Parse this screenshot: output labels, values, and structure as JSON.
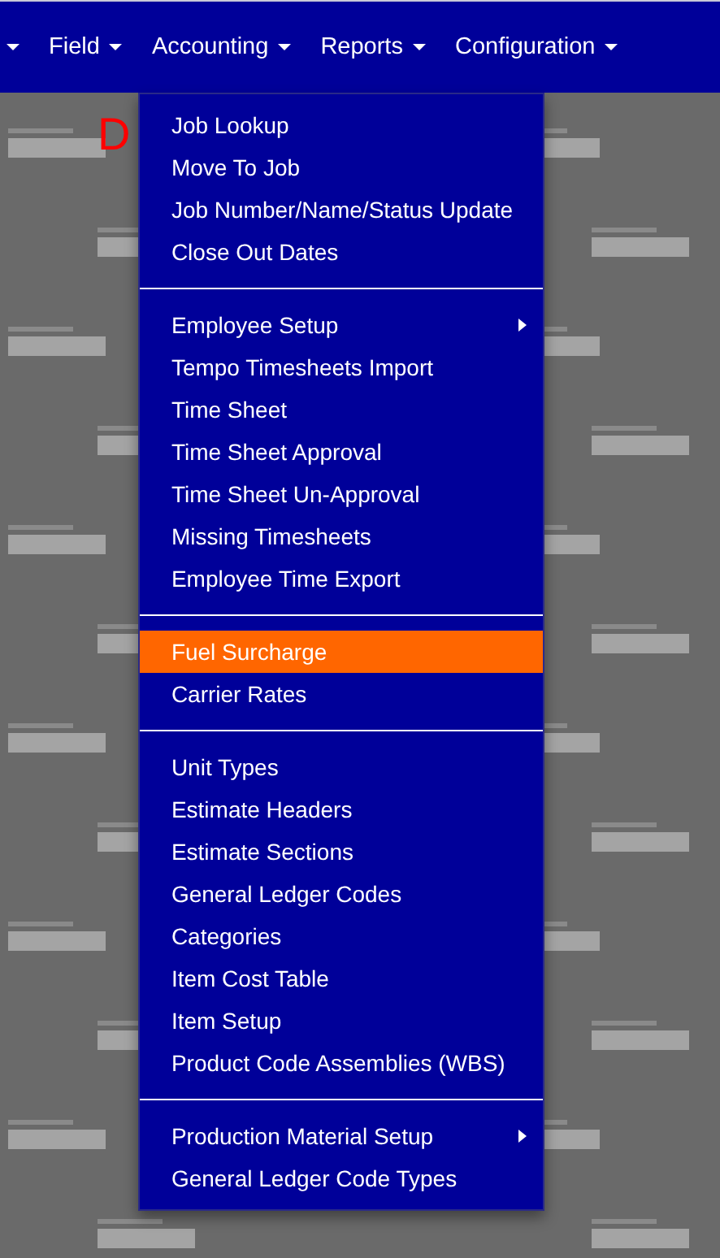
{
  "nav": [
    {
      "expanded": false
    },
    {
      "label": "Field",
      "expanded": false
    },
    {
      "label": "Accounting",
      "expanded": true
    },
    {
      "label": "Reports",
      "expanded": false
    },
    {
      "label": "Configuration",
      "expanded": false
    }
  ],
  "page": {
    "heading": "D"
  },
  "menu": {
    "sections": [
      {
        "items": [
          {
            "label": "Job Lookup",
            "selected": false,
            "has_submenu": false
          },
          {
            "label": "Move To Job",
            "selected": false,
            "has_submenu": false
          },
          {
            "label": "Job Number/Name/Status Update",
            "selected": false,
            "has_submenu": false
          },
          {
            "label": "Close Out Dates",
            "selected": false,
            "has_submenu": false
          }
        ]
      },
      {
        "items": [
          {
            "label": "Employee Setup",
            "selected": false,
            "has_submenu": true
          },
          {
            "label": "Tempo Timesheets Import",
            "selected": false,
            "has_submenu": false
          },
          {
            "label": "Time Sheet",
            "selected": false,
            "has_submenu": false
          },
          {
            "label": "Time Sheet Approval",
            "selected": false,
            "has_submenu": false
          },
          {
            "label": "Time Sheet Un-Approval",
            "selected": false,
            "has_submenu": false
          },
          {
            "label": "Missing Timesheets",
            "selected": false,
            "has_submenu": false
          },
          {
            "label": "Employee Time Export",
            "selected": false,
            "has_submenu": false
          }
        ]
      },
      {
        "items": [
          {
            "label": "Fuel Surcharge",
            "selected": true,
            "has_submenu": false
          },
          {
            "label": "Carrier Rates",
            "selected": false,
            "has_submenu": false
          }
        ]
      },
      {
        "items": [
          {
            "label": "Unit Types",
            "selected": false,
            "has_submenu": false
          },
          {
            "label": "Estimate Headers",
            "selected": false,
            "has_submenu": false
          },
          {
            "label": "Estimate Sections",
            "selected": false,
            "has_submenu": false
          },
          {
            "label": "General Ledger Codes",
            "selected": false,
            "has_submenu": false
          },
          {
            "label": "Categories",
            "selected": false,
            "has_submenu": false
          },
          {
            "label": "Item Cost Table",
            "selected": false,
            "has_submenu": false
          },
          {
            "label": "Item Setup",
            "selected": false,
            "has_submenu": false
          },
          {
            "label": "Product Code Assemblies (WBS)",
            "selected": false,
            "has_submenu": false
          }
        ]
      },
      {
        "items": [
          {
            "label": "Production Material Setup",
            "selected": false,
            "has_submenu": true
          },
          {
            "label": "General Ledger Code Types",
            "selected": false,
            "has_submenu": false
          }
        ]
      }
    ]
  }
}
